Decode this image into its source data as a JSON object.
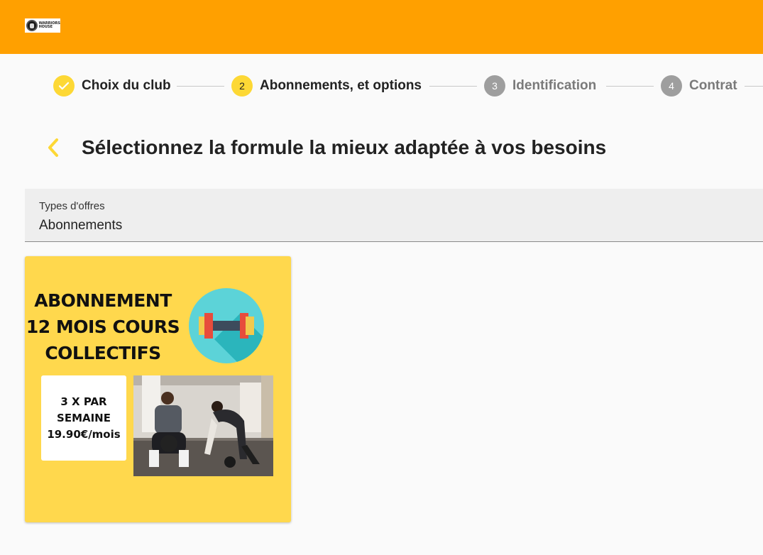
{
  "brand": {
    "logo_line1": "WARRIORS",
    "logo_line2": "HOUSE"
  },
  "stepper": {
    "steps": [
      {
        "number": "",
        "label": "Choix du club",
        "state": "done"
      },
      {
        "number": "2",
        "label": "Abonnements, et options",
        "state": "active"
      },
      {
        "number": "3",
        "label": "Identification",
        "state": "pending"
      },
      {
        "number": "4",
        "label": "Contrat",
        "state": "pending"
      }
    ]
  },
  "page": {
    "title": "Sélectionnez la formule la mieux adaptée à vos besoins"
  },
  "offer_type": {
    "label": "Types d'offres",
    "value": "Abonnements"
  },
  "offers": [
    {
      "title_lines": [
        "ABONNEMENT",
        "12 MOIS COURS",
        "COLLECTIFS"
      ],
      "price_lines": [
        "3 X PAR",
        "SEMAINE",
        "19.90€/mois"
      ],
      "icon": "dumbbell-icon"
    }
  ],
  "colors": {
    "header": "#ffa000",
    "accent": "#fdd835",
    "card": "#ffd84d",
    "pending": "#9e9e9e"
  }
}
